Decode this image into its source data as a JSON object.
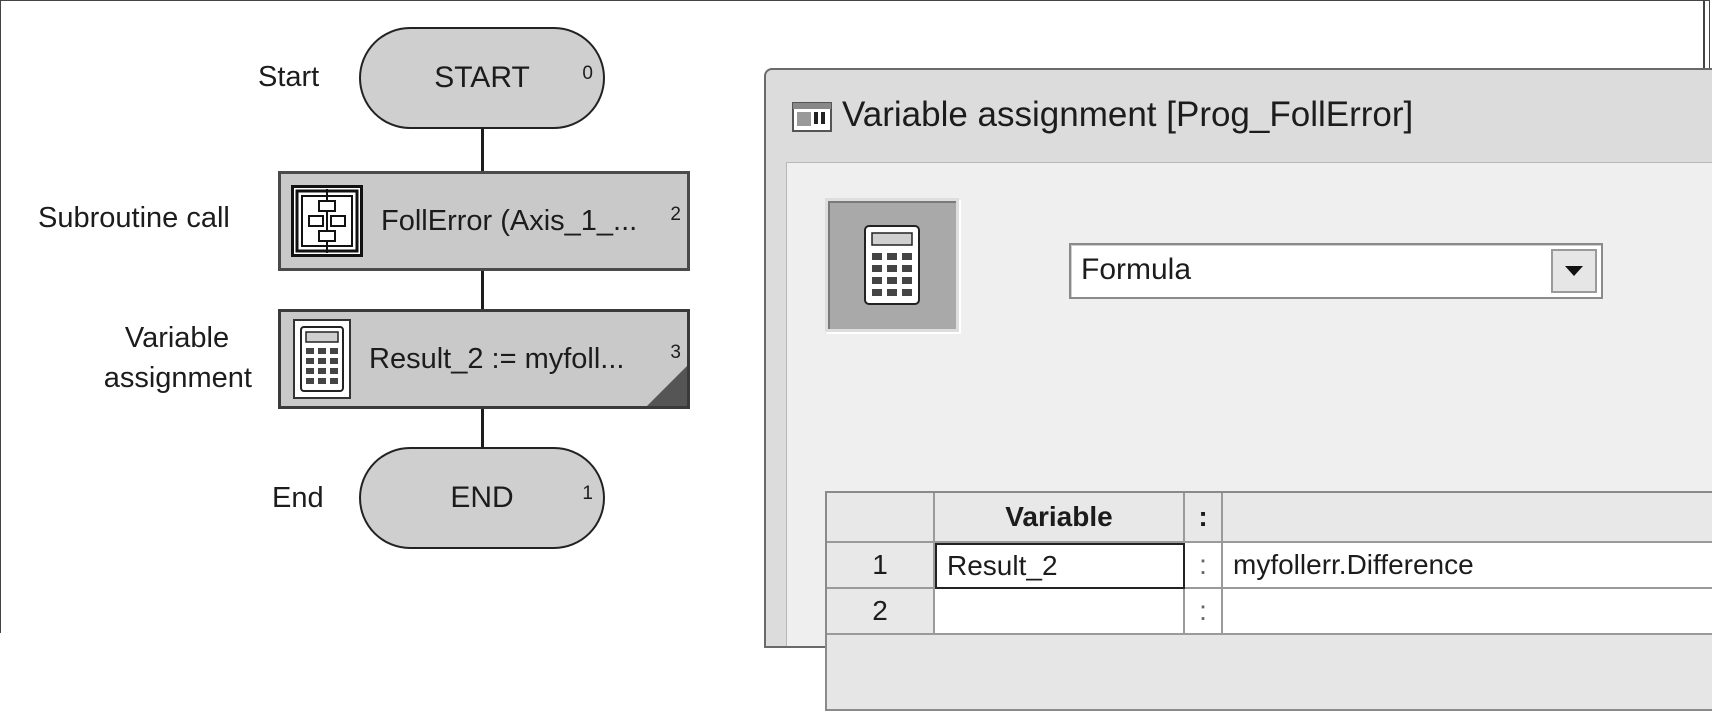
{
  "flowchart": {
    "start": {
      "label": "Start",
      "text": "START",
      "number": "0"
    },
    "subroutine": {
      "label": "Subroutine call",
      "text": "FollError (Axis_1_...",
      "number": "2",
      "icon": "subroutine-icon"
    },
    "assignment": {
      "label_line1": "Variable",
      "label_line2": "assignment",
      "text": "Result_2 := myfoll...",
      "number": "3",
      "icon": "calculator-icon"
    },
    "end": {
      "label": "End",
      "text": "END",
      "number": "1"
    }
  },
  "dialog": {
    "title": "Variable assignment [Prog_FollError]",
    "title_icon": "window-icon",
    "type_button_icon": "calculator-icon",
    "select_value": "Formula",
    "grid": {
      "headers": {
        "rownum": "",
        "variable": "Variable",
        "separator": ":",
        "value": ""
      },
      "rows": [
        {
          "num": "1",
          "variable": "Result_2",
          "sep": ":",
          "value": "myfollerr.Difference"
        },
        {
          "num": "2",
          "variable": "",
          "sep": ":",
          "value": ""
        }
      ]
    }
  },
  "colors": {
    "block_fill": "#c9c9c9",
    "dialog_bg": "#efefef",
    "border": "#4a4a4a"
  }
}
